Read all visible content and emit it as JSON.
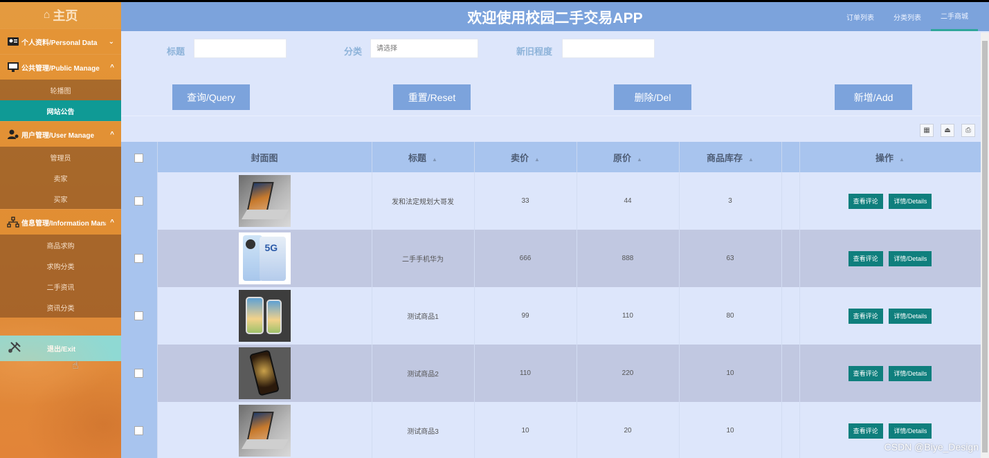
{
  "sidebar": {
    "home_label": "主页",
    "sections": [
      {
        "label": "个人资料/Personal Data",
        "expanded": false,
        "items": []
      },
      {
        "label": "公共管理/Public Manage",
        "expanded": true,
        "items": [
          "轮播图",
          "网站公告"
        ]
      },
      {
        "label": "用户管理/User Manage",
        "expanded": true,
        "items": [
          "管理员",
          "卖家",
          "买家"
        ]
      },
      {
        "label": "信息管理/Information Manage",
        "expanded": true,
        "items": [
          "商品求购",
          "求购分类",
          "二手资讯",
          "资讯分类"
        ]
      }
    ],
    "active_item": "网站公告",
    "exit_label": "退出/Exit"
  },
  "header": {
    "title": "欢迎使用校园二手交易APP",
    "nav": [
      "订单列表",
      "分类列表",
      "二手商城"
    ],
    "active_nav": "二手商城"
  },
  "filters": {
    "title_label": "标题",
    "title_value": "",
    "category_label": "分类",
    "category_placeholder": "请选择",
    "condition_label": "新旧程度",
    "condition_value": ""
  },
  "actions": {
    "query": "查询/Query",
    "reset": "重置/Reset",
    "delete": "删除/Del",
    "add": "新增/Add"
  },
  "table": {
    "columns": [
      "封面图",
      "标题",
      "卖价",
      "原价",
      "商品库存",
      "操作"
    ],
    "rows": [
      {
        "image": "laptop",
        "title": "发和法定规划大哥发",
        "price": "33",
        "original": "44",
        "stock": "3"
      },
      {
        "image": "phone-5g",
        "title": "二手手机华为",
        "price": "666",
        "original": "888",
        "stock": "63"
      },
      {
        "image": "iphones",
        "title": "测试商品1",
        "price": "99",
        "original": "110",
        "stock": "80"
      },
      {
        "image": "dark-phone",
        "title": "测试商品2",
        "price": "110",
        "original": "220",
        "stock": "10"
      },
      {
        "image": "laptop",
        "title": "测试商品3",
        "price": "10",
        "original": "20",
        "stock": "10"
      }
    ],
    "row_buttons": {
      "comments": "查看评论",
      "details": "详情/Details"
    }
  },
  "watermark": "CSDN @Biye_Design",
  "colors": {
    "sidebar": "#e0913a",
    "header": "#7ca3dc",
    "accent_teal": "#0f7f7d",
    "active_item": "#0f9a95",
    "exit": "#8fd9d3"
  }
}
